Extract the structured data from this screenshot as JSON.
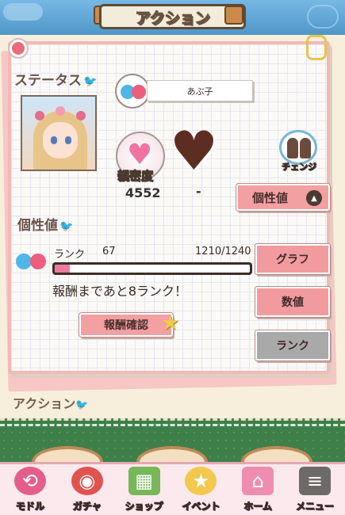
{
  "header": {
    "title": "アクション"
  },
  "status": {
    "section_label": "ステータス",
    "player_name": "あぶ子",
    "intimacy_label": "親密度",
    "intimacy_value": "4552",
    "second_value": "-",
    "change_label": "チェンジ",
    "personality_tab_label": "個性値"
  },
  "personality": {
    "section_label": "個性値",
    "rank_label": "ランク",
    "rank_value": "67",
    "exp_text": "1210/1240",
    "exp_progress": 0.076,
    "reward_message": "報酬まであと8ランク！",
    "reward_button": "報酬確認"
  },
  "side_buttons": {
    "graph": "グラフ",
    "numeric": "数値",
    "rank": "ランク"
  },
  "action": {
    "section_label": "アクション"
  },
  "bottom_nav": [
    {
      "label": "モドル",
      "icon": "back-arrow-icon"
    },
    {
      "label": "ガチャ",
      "icon": "gacha-icon"
    },
    {
      "label": "ショップ",
      "icon": "shop-basket-icon"
    },
    {
      "label": "イベント",
      "icon": "trophy-icon"
    },
    {
      "label": "ホーム",
      "icon": "home-icon"
    },
    {
      "label": "メニュー",
      "icon": "menu-cat-icon"
    }
  ],
  "colors": {
    "accent_pink": "#f29b9e",
    "header_blue": "#5fa6d6",
    "card_border": "#f2b9b6",
    "progress_fill": "#ee7aa0"
  }
}
